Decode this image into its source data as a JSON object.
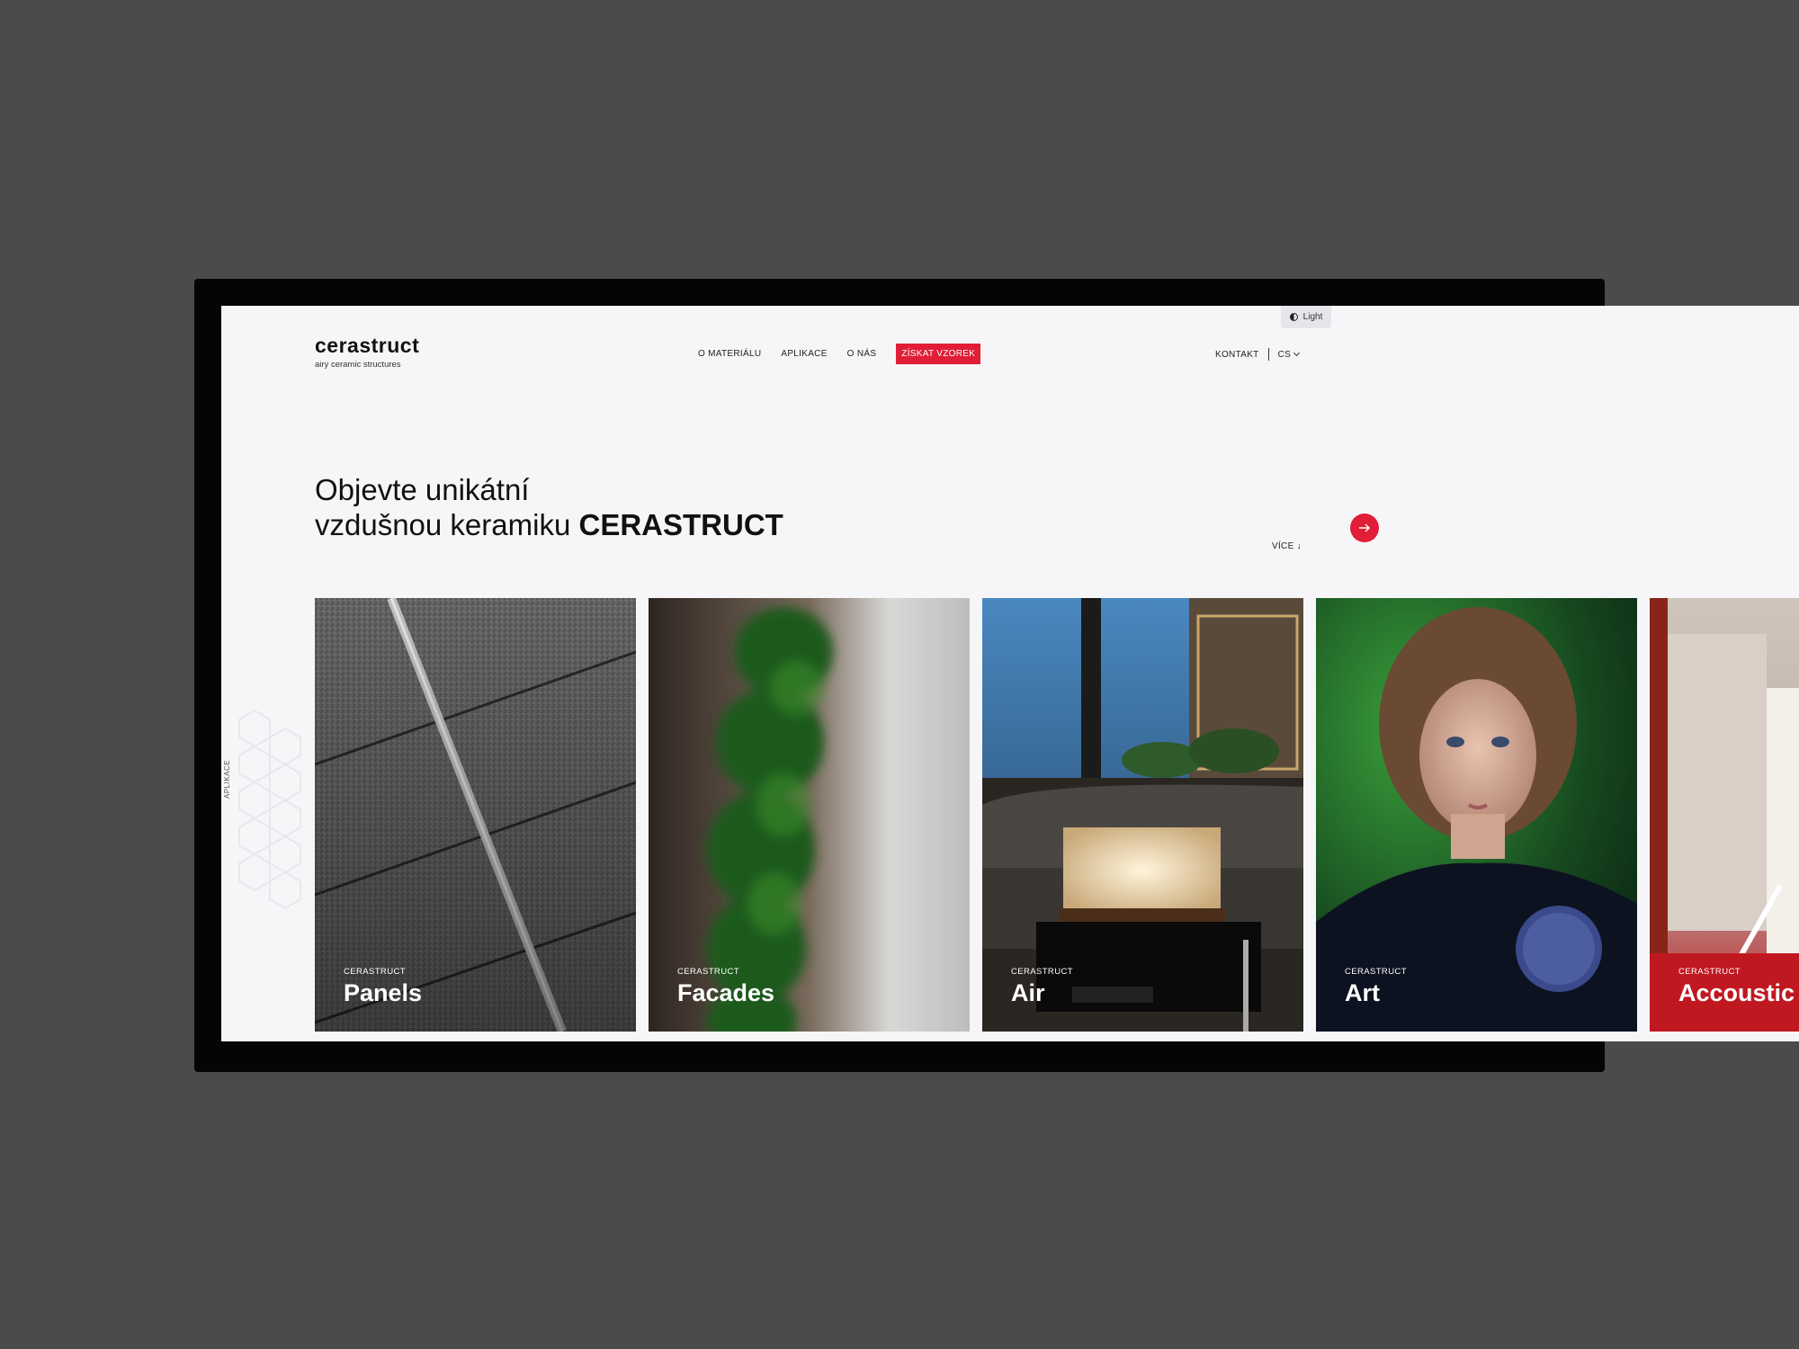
{
  "theme": {
    "label": "Light",
    "icon": "half-circle-icon"
  },
  "brand": {
    "name": "cerastruct",
    "tagline": "airy ceramic structures"
  },
  "nav": {
    "items": [
      "O MATERIÁLU",
      "APLIKACE",
      "O NÁS"
    ],
    "cta": "ZÍSKAT VZOREK",
    "contact": "KONTAKT",
    "language": "CS"
  },
  "hero": {
    "line1": "Objevte unikátní",
    "line2_prefix": "vzdušnou keramiku ",
    "line2_bold": "CERASTRUCT"
  },
  "more": {
    "label": "VÍCE",
    "icon": "arrow-down-icon"
  },
  "side_label": "APLIKACE",
  "cards": [
    {
      "kicker": "CERASTRUCT",
      "title": "Panels"
    },
    {
      "kicker": "CERASTRUCT",
      "title": "Facades"
    },
    {
      "kicker": "CERASTRUCT",
      "title": "Air"
    },
    {
      "kicker": "CERASTRUCT",
      "title": "Art"
    },
    {
      "kicker": "CERASTRUCT",
      "title": "Accoustic"
    }
  ],
  "carousel_next_icon": "arrow-right-icon",
  "colors": {
    "accent": "#e01e35",
    "page_bg": "#f6f6f8",
    "backdrop": "#4b4b4b"
  }
}
